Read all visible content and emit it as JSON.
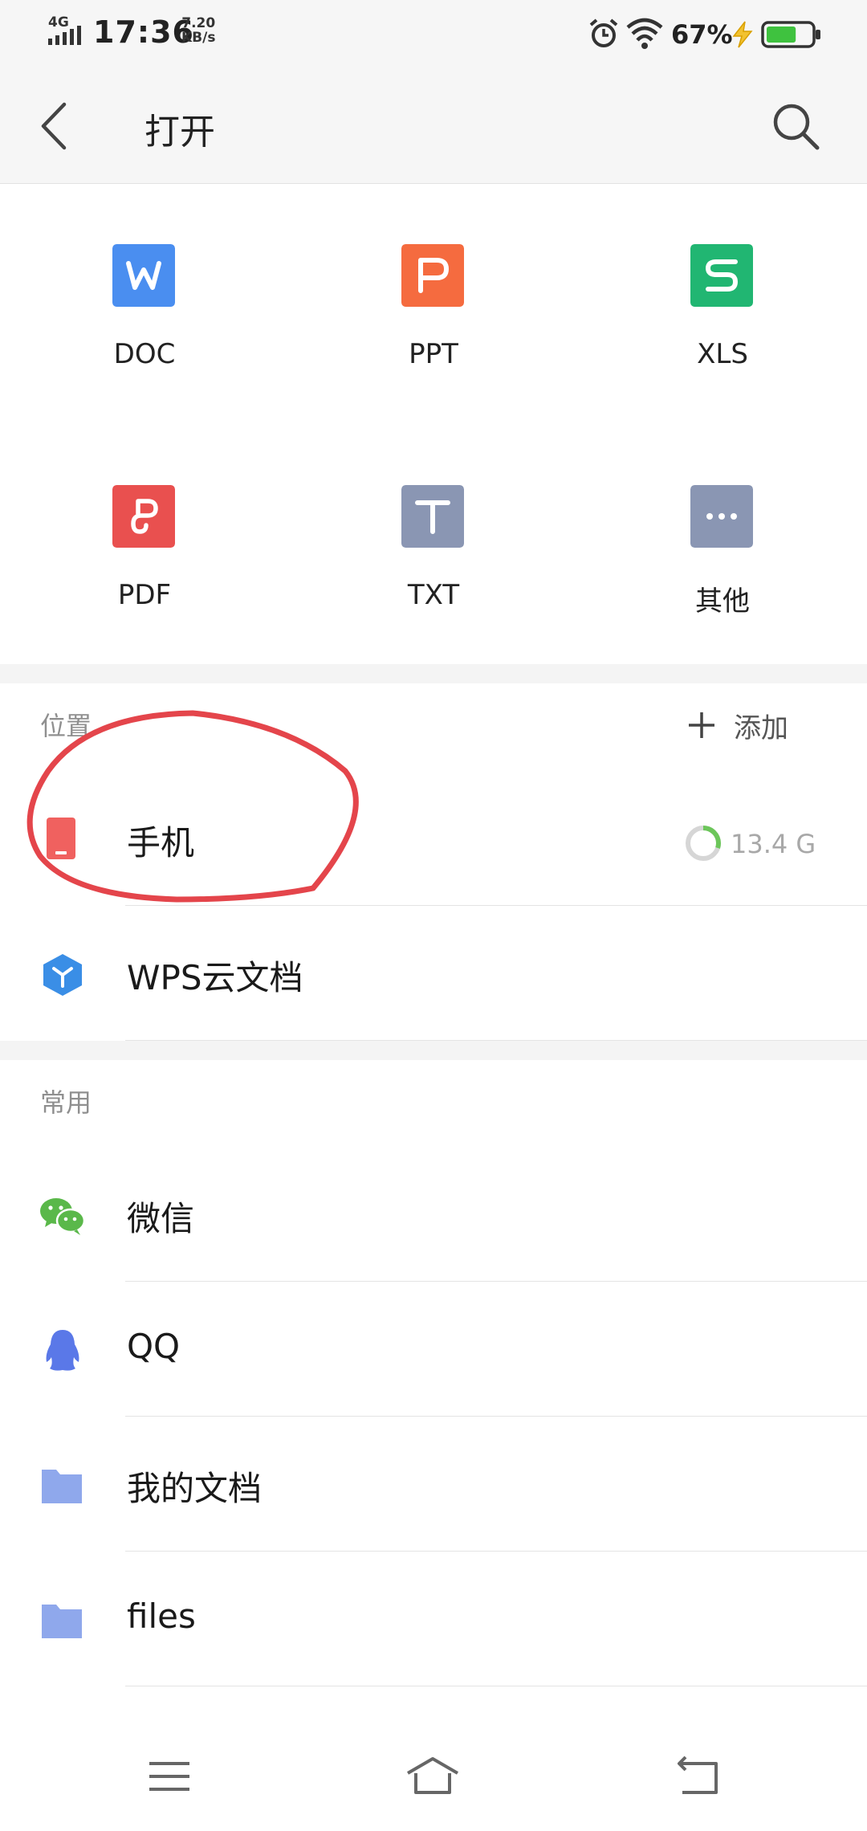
{
  "status_bar": {
    "network": "4G",
    "time": "17:36",
    "speed_value": "7.20",
    "speed_unit": "KB/s",
    "battery_percent": "67%",
    "battery_level": 0.67,
    "icons": [
      "signal-icon",
      "alarm-icon",
      "wifi-icon",
      "charging-icon",
      "battery-icon"
    ]
  },
  "header": {
    "title": "打开",
    "back_icon": "back-arrow-icon",
    "search_icon": "search-icon"
  },
  "file_types": [
    {
      "label": "DOC",
      "icon": "doc-icon",
      "color": "#4a8ef0"
    },
    {
      "label": "PPT",
      "icon": "ppt-icon",
      "color": "#f56b3f"
    },
    {
      "label": "XLS",
      "icon": "xls-icon",
      "color": "#21b672"
    },
    {
      "label": "PDF",
      "icon": "pdf-icon",
      "color": "#e9504f"
    },
    {
      "label": "TXT",
      "icon": "txt-icon",
      "color": "#8a96b3"
    },
    {
      "label": "其他",
      "icon": "more-icon",
      "color": "#8a96b3"
    }
  ],
  "location_section": {
    "title": "位置",
    "add_label": "添加",
    "items": [
      {
        "label": "手机",
        "icon": "phone-icon",
        "storage": "13.4 G",
        "storage_used_fraction": 0.3
      },
      {
        "label": "WPS云文档",
        "icon": "wps-cloud-icon"
      }
    ]
  },
  "common_section": {
    "title": "常用",
    "items": [
      {
        "label": "微信",
        "icon": "wechat-icon"
      },
      {
        "label": "QQ",
        "icon": "qq-icon"
      },
      {
        "label": "我的文档",
        "icon": "folder-icon"
      },
      {
        "label": "files",
        "icon": "folder-icon"
      }
    ]
  },
  "nav_bar": {
    "icons": [
      "menu-icon",
      "home-icon",
      "return-icon"
    ]
  },
  "colors": {
    "annotation_circle": "#e4454b",
    "storage_ring": "#6cc65a",
    "folder": "#8fa8ec",
    "qq": "#5a78e8",
    "wechat": "#5ab84a",
    "wps_cloud": "#3a8ee6",
    "battery": "#3fc23f"
  }
}
